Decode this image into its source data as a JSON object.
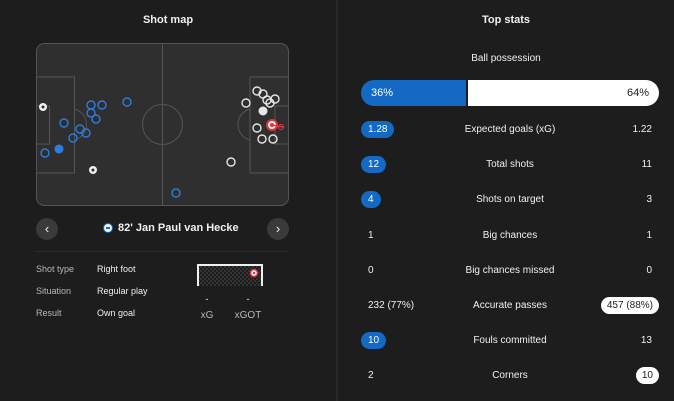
{
  "left": {
    "title": "Shot map",
    "prev_icon": "chevron-left-icon",
    "next_icon": "chevron-right-icon",
    "shot": {
      "minute": "82'",
      "player": "Jan Paul van Hecke",
      "label": "82' Jan Paul van Hecke"
    },
    "details": [
      {
        "key": "Shot type",
        "value": "Right foot"
      },
      {
        "key": "Situation",
        "value": "Regular play"
      },
      {
        "key": "Result",
        "value": "Own goal"
      }
    ],
    "xg": {
      "value": "-",
      "label": "xG"
    },
    "xgot": {
      "value": "-",
      "label": "xGOT"
    }
  },
  "right": {
    "title": "Top stats",
    "possession": {
      "label": "Ball possession",
      "home": "36%",
      "away": "64%",
      "home_fraction": 0.36
    },
    "stats": [
      {
        "name": "Expected goals (xG)",
        "home": "1.28",
        "away": "1.22",
        "highlight": "home"
      },
      {
        "name": "Total shots",
        "home": "12",
        "away": "11",
        "highlight": "home"
      },
      {
        "name": "Shots on target",
        "home": "4",
        "away": "3",
        "highlight": "home"
      },
      {
        "name": "Big chances",
        "home": "1",
        "away": "1",
        "highlight": "none"
      },
      {
        "name": "Big chances missed",
        "home": "0",
        "away": "0",
        "highlight": "none"
      },
      {
        "name": "Accurate passes",
        "home": "232 (77%)",
        "away": "457 (88%)",
        "highlight": "away"
      },
      {
        "name": "Fouls committed",
        "home": "10",
        "away": "13",
        "highlight": "home"
      },
      {
        "name": "Corners",
        "home": "2",
        "away": "10",
        "highlight": "away"
      }
    ]
  },
  "colors": {
    "home": "#1469c4",
    "away": "#ffffff",
    "background": "#1d1d1d",
    "selected_shot": "#e0353a"
  }
}
